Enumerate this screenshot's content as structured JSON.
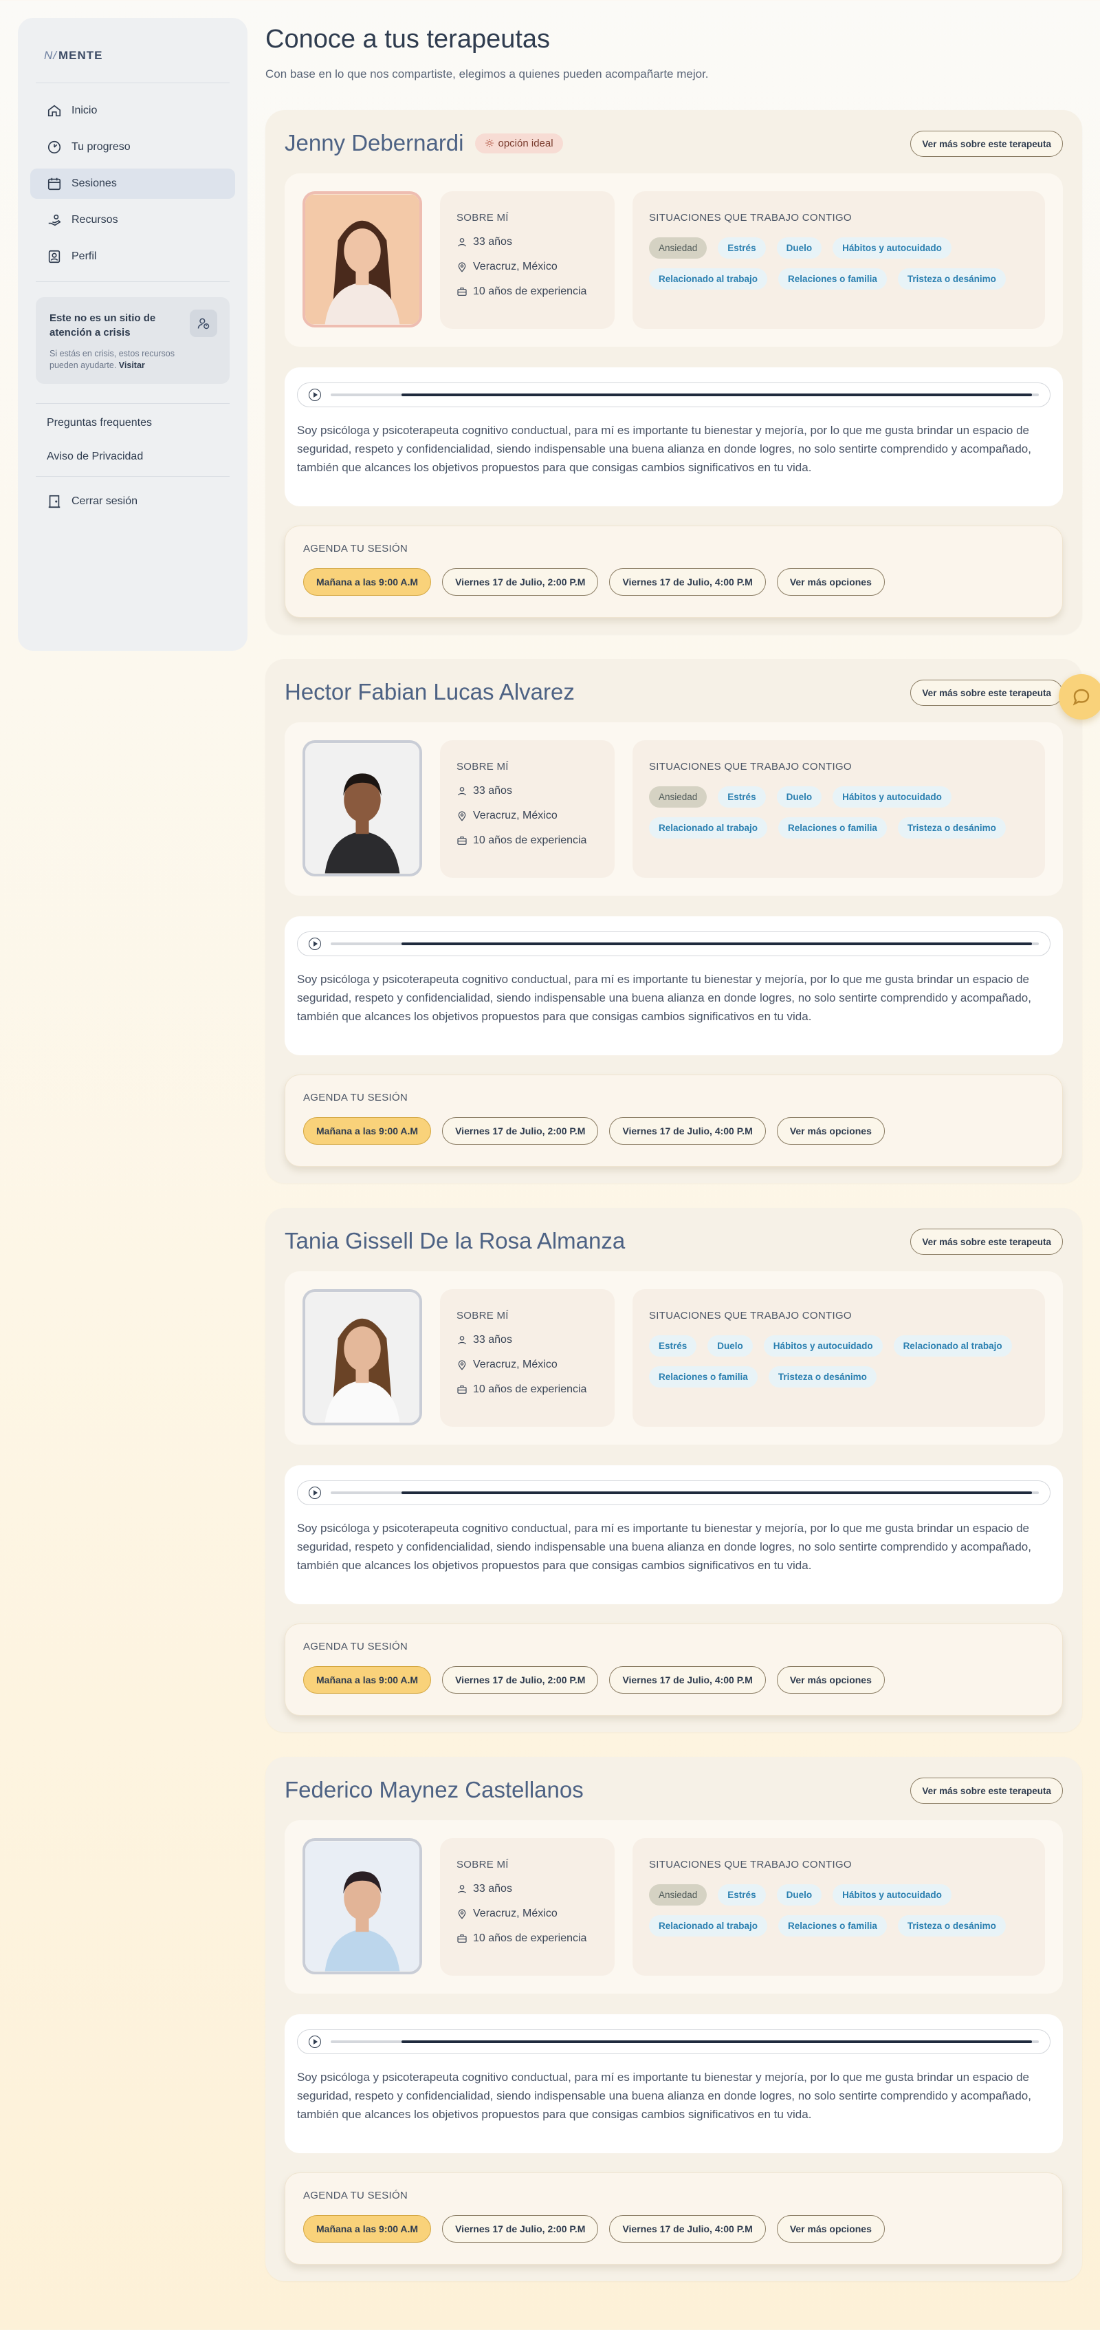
{
  "brand": {
    "logo_text": "MENTE",
    "logo_mark": "N/"
  },
  "sidebar": {
    "items": [
      {
        "label": "Inicio",
        "icon": "home-icon"
      },
      {
        "label": "Tu progreso",
        "icon": "progress-icon"
      },
      {
        "label": "Sesiones",
        "icon": "calendar-icon",
        "active": true
      },
      {
        "label": "Recursos",
        "icon": "resources-icon"
      },
      {
        "label": "Perfil",
        "icon": "profile-icon"
      }
    ],
    "crisis": {
      "title": "Este no es un sitio de atención a crisis",
      "text": "Si estás en crisis, estos recursos pueden ayudarte.",
      "link": "Visitar"
    },
    "faq": "Preguntas frequentes",
    "privacy": "Aviso de Privacidad",
    "logout": "Cerrar sesión"
  },
  "page": {
    "title": "Conoce a tus terapeutas",
    "subtitle": "Con base en lo que nos compartiste, elegimos a quienes pueden acompañarte mejor."
  },
  "labels": {
    "more_button": "Ver más sobre este terapeuta",
    "about_title": "SOBRE MÍ",
    "situations_title": "SITUACIONES QUE TRABAJO CONTIGO",
    "agenda_title": "AGENDA TU SESIÓN",
    "ideal_badge": "opción ideal"
  },
  "therapists": [
    {
      "name": "Jenny Debernardi",
      "ideal": true,
      "age": "33 años",
      "location": "Veracruz, México",
      "experience": "10 años de experiencia",
      "tags": [
        "Ansiedad",
        "Estrés",
        "Duelo",
        "Hábitos y autocuidado",
        "Relacionado al trabajo",
        "Relaciones o familia",
        "Tristeza o desánimo"
      ],
      "primary_tag": "Ansiedad",
      "audio_progress": 0.1,
      "bio": "Soy psicóloga y psicoterapeuta cognitivo conductual, para mí es importante tu bienestar y mejoría, por lo que me gusta brindar un espacio de seguridad, respeto y confidencialidad, siendo indispensable una buena alianza en donde logres, no solo sentirte comprendido y acompañado, también que alcances los objetivos propuestos para que consigas cambios significativos en tu vida.",
      "slots": [
        "Mañana a las 9:00 A.M",
        "Viernes 17 de Julio, 2:00 P.M",
        "Viernes 17 de Julio, 4:00 P.M",
        "Ver más opciones"
      ]
    },
    {
      "name": "Hector Fabian Lucas Alvarez",
      "ideal": false,
      "age": "33 años",
      "location": "Veracruz, México",
      "experience": "10 años de experiencia",
      "tags": [
        "Ansiedad",
        "Estrés",
        "Duelo",
        "Hábitos y autocuidado",
        "Relacionado al trabajo",
        "Relaciones o familia",
        "Tristeza o desánimo"
      ],
      "primary_tag": "Ansiedad",
      "audio_progress": 0.1,
      "bio": "Soy psicóloga y psicoterapeuta cognitivo conductual, para mí es importante tu bienestar y mejoría, por lo que me gusta brindar un espacio de seguridad, respeto y confidencialidad, siendo indispensable una buena alianza en donde logres, no solo sentirte comprendido y acompañado, también que alcances los objetivos propuestos para que consigas cambios significativos en tu vida.",
      "slots": [
        "Mañana a las 9:00 A.M",
        "Viernes 17 de Julio, 2:00 P.M",
        "Viernes 17 de Julio, 4:00 P.M",
        "Ver más opciones"
      ]
    },
    {
      "name": "Tania Gissell De la Rosa Almanza",
      "ideal": false,
      "age": "33 años",
      "location": "Veracruz, México",
      "experience": "10 años de experiencia",
      "tags": [
        "Estrés",
        "Duelo",
        "Hábitos y autocuidado",
        "Relacionado al trabajo",
        "Relaciones o familia",
        "Tristeza o desánimo"
      ],
      "primary_tag": "",
      "audio_progress": 0.1,
      "bio": "Soy psicóloga y psicoterapeuta cognitivo conductual, para mí es importante tu bienestar y mejoría, por lo que me gusta brindar un espacio de seguridad, respeto y confidencialidad, siendo indispensable una buena alianza en donde logres, no solo sentirte comprendido y acompañado, también que alcances los objetivos propuestos para que consigas cambios significativos en tu vida.",
      "slots": [
        "Mañana a las 9:00 A.M",
        "Viernes 17 de Julio, 2:00 P.M",
        "Viernes 17 de Julio, 4:00 P.M",
        "Ver más opciones"
      ]
    },
    {
      "name": "Federico Maynez Castellanos",
      "ideal": false,
      "age": "33 años",
      "location": "Veracruz, México",
      "experience": "10 años de experiencia",
      "tags": [
        "Ansiedad",
        "Estrés",
        "Duelo",
        "Hábitos y autocuidado",
        "Relacionado al trabajo",
        "Relaciones o familia",
        "Tristeza o desánimo"
      ],
      "primary_tag": "Ansiedad",
      "audio_progress": 0.1,
      "bio": "Soy psicóloga y psicoterapeuta cognitivo conductual, para mí es importante tu bienestar y mejoría, por lo que me gusta brindar un espacio de seguridad, respeto y confidencialidad, siendo indispensable una buena alianza en donde logres, no solo sentirte comprendido y acompañado, también que alcances los objetivos propuestos para que consigas cambios significativos en tu vida.",
      "slots": [
        "Mañana a las 9:00 A.M",
        "Viernes 17 de Julio, 2:00 P.M",
        "Viernes 17 de Julio, 4:00 P.M",
        "Ver más opciones"
      ]
    }
  ]
}
